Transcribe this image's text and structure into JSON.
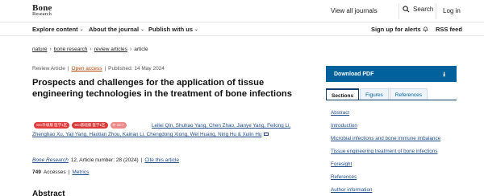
{
  "header": {
    "logo_line1": "Bone",
    "logo_line2": "Research",
    "view_all_journals": "View all journals",
    "search": "Search",
    "login": "Log in"
  },
  "nav": {
    "explore": "Explore content",
    "about": "About the journal",
    "publish": "Publish with us",
    "signup": "Sign up for alerts",
    "rss": "RSS feed"
  },
  "breadcrumb": [
    "nature",
    "bone research",
    "review articles",
    "article"
  ],
  "meta": {
    "type": "Review Article",
    "access": "Open access",
    "published": "Published: 14 May 2024"
  },
  "article": {
    "title": "Prospects and challenges for the application of tissue engineering technologies in the treatment of bone infections",
    "badges": [
      "SCI升级版 医学1区",
      "SCI基础版 医学1区",
      "IF 12.7"
    ],
    "authors": "Leilei Qin, Shuhao Yang, Chen Zhao, Jianye Yang, Feilong Li, Zhenghao Xu, Yaji Yang, Haotian Zhou, Kainan Li, Chengdong Xiong, Wei Huang, Ning Hu & Xulin Hu",
    "citation_journal": "Bone Research",
    "citation_rest": "12, Article number: 28 (2024)",
    "cite_link": "Cite this article",
    "accesses_count": "749",
    "accesses_label": "Accesses",
    "metrics_link": "Metrics",
    "abstract_heading": "Abstract"
  },
  "sidebar": {
    "download": "Download PDF",
    "tabs": [
      "Sections",
      "Figures",
      "References"
    ],
    "toc": [
      "Abstract",
      "Introduction",
      "Microbial infections and bone immune imbalance",
      "Tissue engineering treatment of bone infections",
      "Foresight",
      "References",
      "Author information"
    ]
  }
}
